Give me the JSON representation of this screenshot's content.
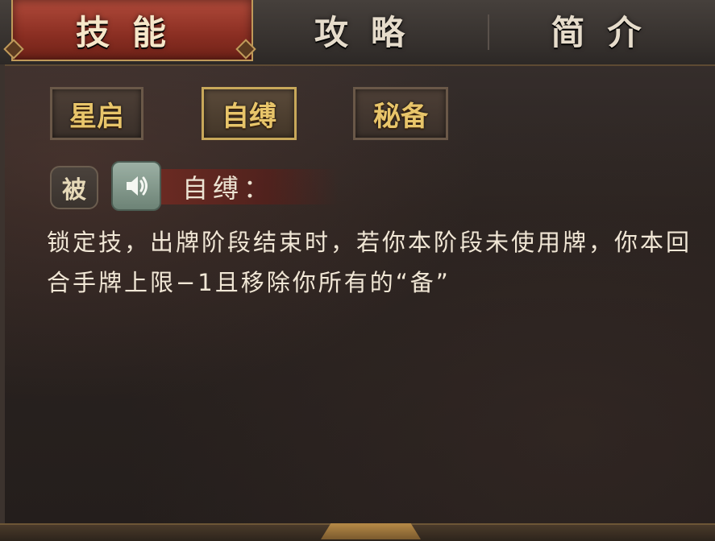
{
  "tabs": [
    {
      "label": "技能",
      "active": true
    },
    {
      "label": "攻略",
      "active": false
    },
    {
      "label": "简介",
      "active": false
    }
  ],
  "skills": [
    {
      "label": "星启",
      "selected": false
    },
    {
      "label": "自缚",
      "selected": true
    },
    {
      "label": "秘备",
      "selected": false
    }
  ],
  "skill_detail": {
    "type_tag": "被",
    "sound_icon": "speaker-icon",
    "name": "自缚：",
    "description": "锁定技，出牌阶段结束时，若你本阶段未使用牌，你本回合手牌上限−1且移除你所有的“备”"
  },
  "colors": {
    "active_tab": "#8a2e22",
    "gold_text": "#e8c56a",
    "frame_border": "#c09a5a"
  }
}
